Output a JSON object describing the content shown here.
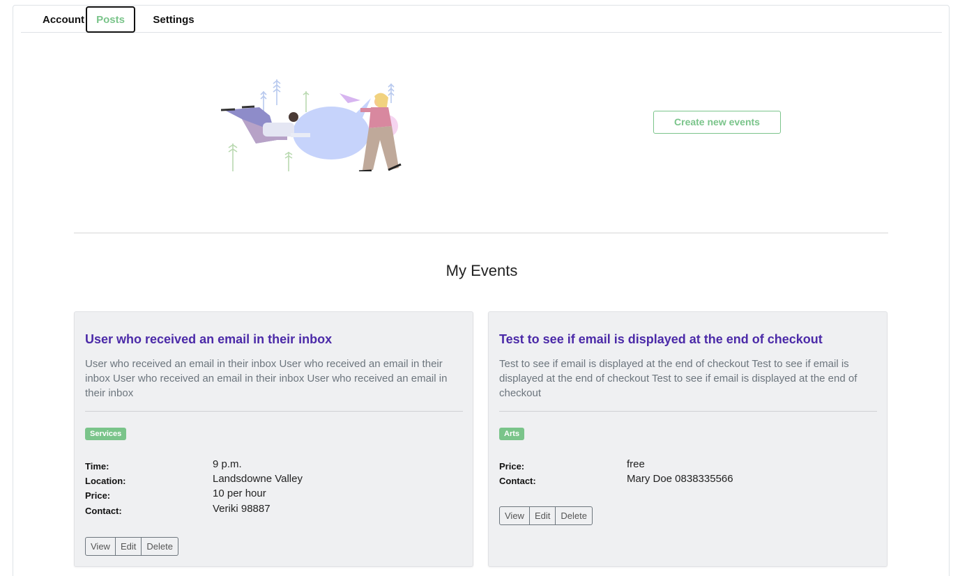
{
  "tabs": [
    {
      "label": "Account",
      "active": false
    },
    {
      "label": "Posts",
      "active": true
    },
    {
      "label": "Settings",
      "active": false
    }
  ],
  "hero": {
    "illustration": "people-paper-plane-illustration",
    "create_button": "Create new events"
  },
  "section_title": "My Events",
  "events": [
    {
      "title": "User who received an email in their inbox",
      "description": "User who received an email in their inbox User who received an email in their inbox User who received an email in their inbox User who received an email in their inbox",
      "category": "Services",
      "details": [
        {
          "label": "Time:",
          "value": "9 p.m."
        },
        {
          "label": "Location:",
          "value": "Landsdowne Valley"
        },
        {
          "label": "Price:",
          "value": "10 per hour"
        },
        {
          "label": "Contact:",
          "value": "Veriki 98887"
        }
      ],
      "actions": [
        "View",
        "Edit",
        "Delete"
      ]
    },
    {
      "title": "Test to see if email is displayed at the end of checkout",
      "description": "Test to see if email is displayed at the end of checkout Test to see if email is displayed at the end of checkout Test to see if email is displayed at the end of checkout",
      "category": "Arts",
      "details": [
        {
          "label": "Price:",
          "value": "free"
        },
        {
          "label": "Contact:",
          "value": "Mary Doe 0838335566"
        }
      ],
      "actions": [
        "View",
        "Edit",
        "Delete"
      ]
    }
  ],
  "colors": {
    "accent_green": "#7ac48a",
    "title_purple": "#4b2aa8",
    "card_bg": "#eff0f2"
  }
}
